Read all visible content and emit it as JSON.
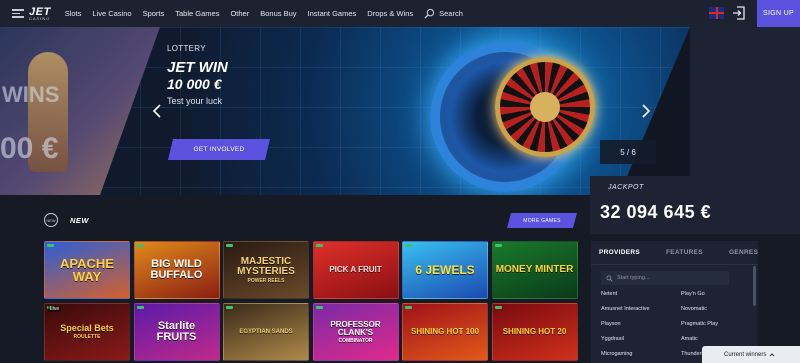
{
  "header": {
    "logo_main": "JET",
    "logo_sub": "CASINO",
    "nav": [
      "Slots",
      "Live Casino",
      "Sports",
      "Table Games",
      "Other",
      "Bonus Buy",
      "Instant Games",
      "Drops & Wins"
    ],
    "search_label": "Search",
    "signup_label": "SIGN UP",
    "accent_color": "#5b52e0"
  },
  "hero": {
    "left_peek_top": "WINS",
    "left_peek_bottom": "00 €",
    "category": "LOTTERY",
    "title_line1": "JET WIN",
    "title_line2": "10 000 €",
    "subtitle": "Test your luck",
    "cta_label": "GET INVOLVED",
    "slide_counter": "5 / 6"
  },
  "jackpot": {
    "label": "JACKPOT",
    "amount": "32 094 645 €"
  },
  "games_section": {
    "title": "NEW",
    "more_label": "MORE GAMES",
    "games": [
      {
        "name": "APACHE WAY",
        "sub": "",
        "bg": "linear-gradient(160deg,#2a5fd8,#d6602a)",
        "color": "#ffd23a",
        "size": 13
      },
      {
        "name": "BIG WILD BUFFALO",
        "sub": "",
        "bg": "linear-gradient(160deg,#e08a1c,#8a1e12)",
        "color": "#ffffff",
        "size": 11
      },
      {
        "name": "MAJESTIC MYSTERIES",
        "sub": "POWER REELS",
        "bg": "linear-gradient(160deg,#2a1a12,#6a4a2a)",
        "color": "#f3d27a",
        "size": 10
      },
      {
        "name": "PICK A FRUIT",
        "sub": "",
        "bg": "linear-gradient(160deg,#e0302a,#8a0f12)",
        "color": "#ffe2e2",
        "size": 8
      },
      {
        "name": "6 JEWELS",
        "sub": "",
        "bg": "linear-gradient(160deg,#3ac0f0,#1a4ab0)",
        "color": "#ffe03a",
        "size": 12
      },
      {
        "name": "MONEY MINTER",
        "sub": "",
        "bg": "linear-gradient(160deg,#1a7a2a,#0a3a1a)",
        "color": "#ffd23a",
        "size": 10
      },
      {
        "name": "Special Bets",
        "sub": "ROULETTE",
        "bg": "linear-gradient(160deg,#3a0a0a,#8a1a1a)",
        "color": "#ffd23a",
        "size": 9,
        "live": "Live"
      },
      {
        "name": "Starlite FRUITS",
        "sub": "",
        "bg": "linear-gradient(160deg,#5a1aa8,#c02a8a)",
        "color": "#ffffff",
        "size": 11
      },
      {
        "name": "EGYPTIAN SANDS",
        "sub": "",
        "bg": "linear-gradient(160deg,#3a2a1a,#b08a4a)",
        "color": "#f3d27a",
        "size": 6
      },
      {
        "name": "PROFESSOR CLANK'S",
        "sub": "COMBINATOR",
        "bg": "linear-gradient(160deg,#7a2aa8,#e02a8a)",
        "color": "#ffffff",
        "size": 8
      },
      {
        "name": "SHINING HOT 100",
        "sub": "",
        "bg": "linear-gradient(160deg,#a0121a,#e05a1a)",
        "color": "#ffd23a",
        "size": 8
      },
      {
        "name": "SHINING HOT 20",
        "sub": "",
        "bg": "linear-gradient(160deg,#7a0a10,#d0301a)",
        "color": "#ffd23a",
        "size": 8
      }
    ]
  },
  "providers": {
    "tabs": [
      "PROVIDERS",
      "FEATURES",
      "GENRES"
    ],
    "active_tab": 0,
    "search_placeholder": "Start typing...",
    "list": [
      "Netent",
      "Play'n Go",
      "Amusnet Interactive",
      "Novomatic",
      "Playson",
      "Pragmatic Play",
      "Yggdrasil",
      "Amatic",
      "Microgaming",
      "Thunderkick"
    ]
  },
  "winners": {
    "label": "Current winners"
  }
}
